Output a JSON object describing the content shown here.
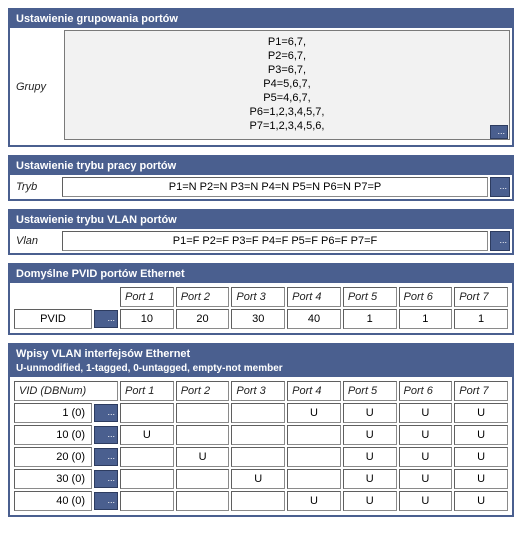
{
  "panels": {
    "groups": {
      "title": "Ustawienie grupowania portów",
      "label": "Grupy",
      "value": "P1=6,7,\nP2=6,7,\nP3=6,7,\nP4=5,6,7,\nP5=4,6,7,\nP6=1,2,3,4,5,7,\nP7=1,2,3,4,5,6,"
    },
    "mode": {
      "title": "Ustawienie trybu pracy portów",
      "label": "Tryb",
      "value": "P1=N P2=N P3=N P4=N P5=N P6=N P7=P"
    },
    "vlan_mode": {
      "title": "Ustawienie trybu VLAN portów",
      "label": "Vlan",
      "value": "P1=F P2=F P3=F P4=F P5=F P6=F P7=F"
    },
    "pvid": {
      "title": "Domyślne PVID portów Ethernet",
      "row_label": "PVID",
      "headers": [
        "Port 1",
        "Port 2",
        "Port 3",
        "Port 4",
        "Port 5",
        "Port 6",
        "Port 7"
      ],
      "values": [
        "10",
        "20",
        "30",
        "40",
        "1",
        "1",
        "1"
      ]
    },
    "vlan_entries": {
      "title": "Wpisy VLAN interfejsów Ethernet",
      "subtitle": "U-unmodified, 1-tagged, 0-untagged, empty-not member",
      "vid_header": "VID (DBNum)",
      "headers": [
        "Port 1",
        "Port 2",
        "Port 3",
        "Port 4",
        "Port 5",
        "Port 6",
        "Port 7"
      ],
      "rows": [
        {
          "vid": "1 (0)",
          "cells": [
            "",
            "",
            "",
            "U",
            "U",
            "U",
            "U"
          ]
        },
        {
          "vid": "10 (0)",
          "cells": [
            "U",
            "",
            "",
            "",
            "U",
            "U",
            "U"
          ]
        },
        {
          "vid": "20 (0)",
          "cells": [
            "",
            "U",
            "",
            "",
            "U",
            "U",
            "U"
          ]
        },
        {
          "vid": "30 (0)",
          "cells": [
            "",
            "",
            "U",
            "",
            "U",
            "U",
            "U"
          ]
        },
        {
          "vid": "40 (0)",
          "cells": [
            "",
            "",
            "",
            "U",
            "U",
            "U",
            "U"
          ]
        }
      ]
    }
  },
  "btn_glyph": "..."
}
